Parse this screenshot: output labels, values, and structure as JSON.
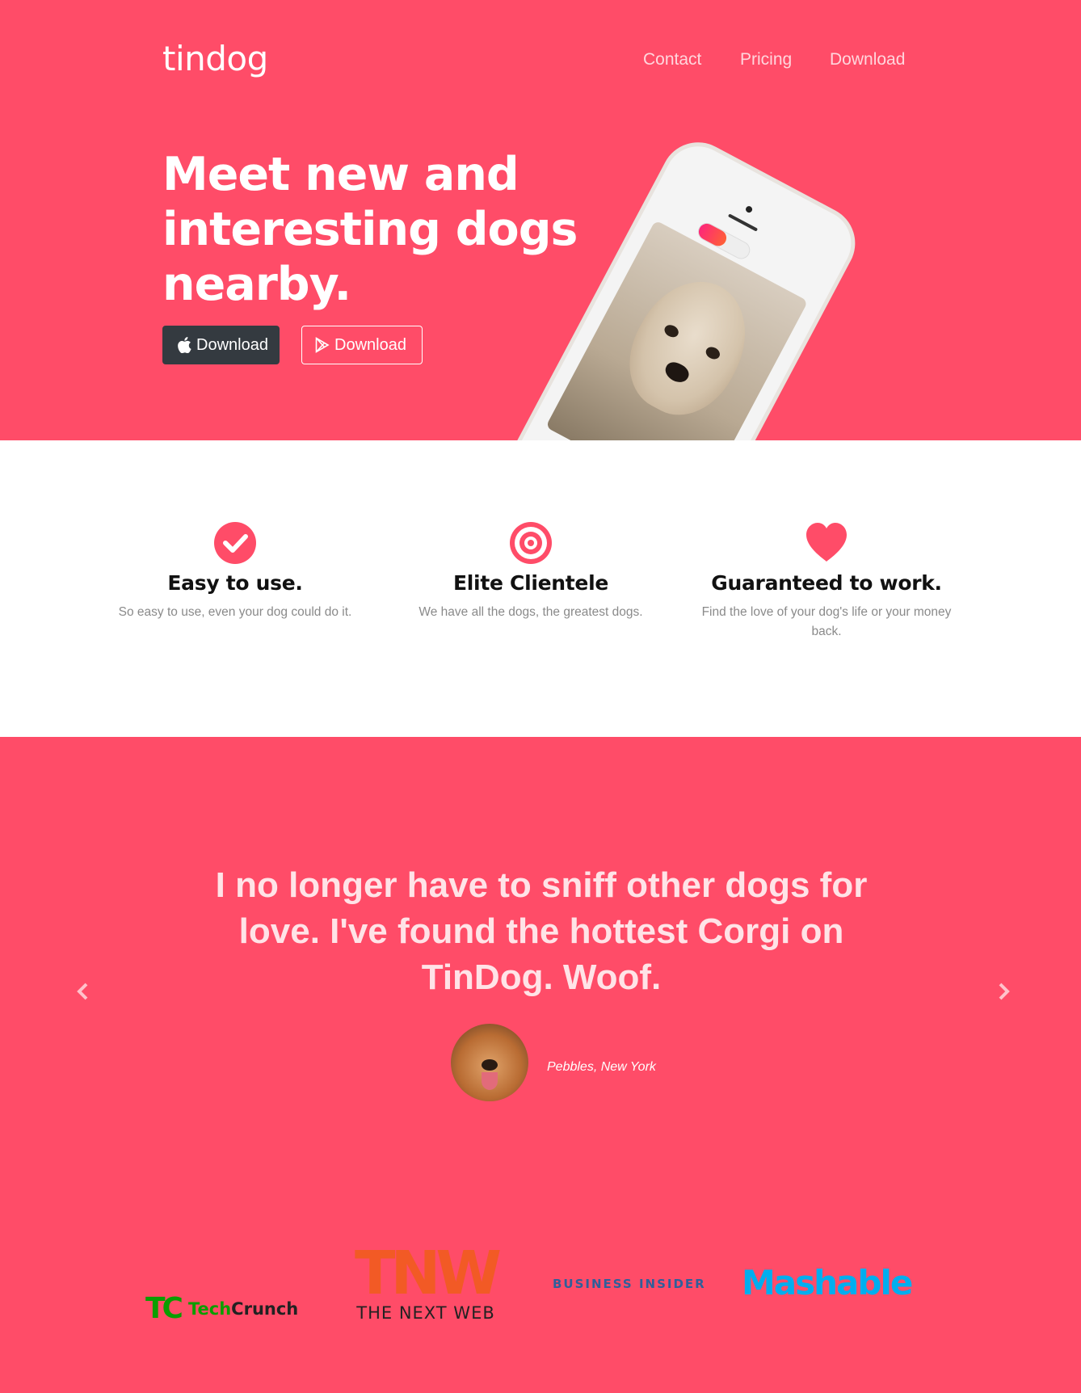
{
  "nav": {
    "brand": "tindog",
    "links": [
      "Contact",
      "Pricing",
      "Download"
    ]
  },
  "hero": {
    "headline": "Meet new and interesting dogs nearby.",
    "buttons": [
      {
        "label": "Download",
        "icon": "apple-icon"
      },
      {
        "label": "Download",
        "icon": "google-play-icon"
      }
    ]
  },
  "features": [
    {
      "icon": "check-circle-icon",
      "title": "Easy to use.",
      "text": "So easy to use, even your dog could do it."
    },
    {
      "icon": "bullseye-icon",
      "title": "Elite Clientele",
      "text": "We have all the dogs, the greatest dogs."
    },
    {
      "icon": "heart-icon",
      "title": "Guaranteed to work.",
      "text": "Find the love of your dog's life or your money back."
    }
  ],
  "testimonial": {
    "quote": "I no longer have to sniff other dogs for love. I've found the hottest Corgi on TinDog. Woof.",
    "caption": "Pebbles, New York"
  },
  "press": {
    "techcrunch": {
      "mark": "TC",
      "text_a": "Tech",
      "text_b": "Crunch"
    },
    "tnw": {
      "mark": "TNW",
      "text": "THE NEXT WEB"
    },
    "business_insider": "BUSINESS INSIDER",
    "mashable": "Mashable"
  },
  "colors": {
    "accent": "#ff4c68",
    "dark_button": "#343a40",
    "feature_icon": "#ff4c68"
  }
}
